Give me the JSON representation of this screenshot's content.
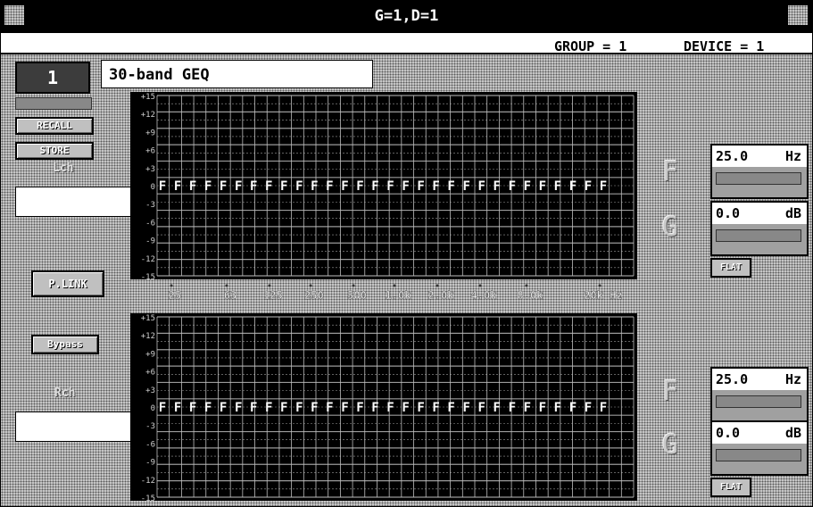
{
  "window": {
    "title": "G=1,D=1"
  },
  "status": {
    "group": "GROUP = 1",
    "device": "DEVICE = 1"
  },
  "channel": {
    "number": "1",
    "name": "30-band GEQ"
  },
  "left": {
    "recall": "RECALL",
    "store": "STORE",
    "lch": "Lch",
    "plink": "P.LINK",
    "bypass": "Bypass",
    "rch": "Rch"
  },
  "eq": {
    "db_ticks": [
      "+15",
      "+12",
      "+9",
      "+6",
      "+3",
      "0",
      "-3",
      "-6",
      "-9",
      "-12",
      "-15"
    ],
    "freq_labels": [
      "25",
      "63",
      "125",
      "250",
      "500",
      "1.0k",
      "2.0k",
      "4.0k",
      "8.0k",
      "20k Hz"
    ],
    "band_marker": "F",
    "band_count": 30,
    "band_gain_db": 0
  },
  "lch_edit": {
    "f_label": "F",
    "g_label": "G",
    "freq": "25.0",
    "freq_unit": "Hz",
    "gain": "0.0",
    "gain_unit": "dB",
    "flat": "FLAT"
  },
  "rch_edit": {
    "f_label": "F",
    "g_label": "G",
    "freq": "25.0",
    "freq_unit": "Hz",
    "gain": "0.0",
    "gain_unit": "dB",
    "flat": "FLAT"
  }
}
